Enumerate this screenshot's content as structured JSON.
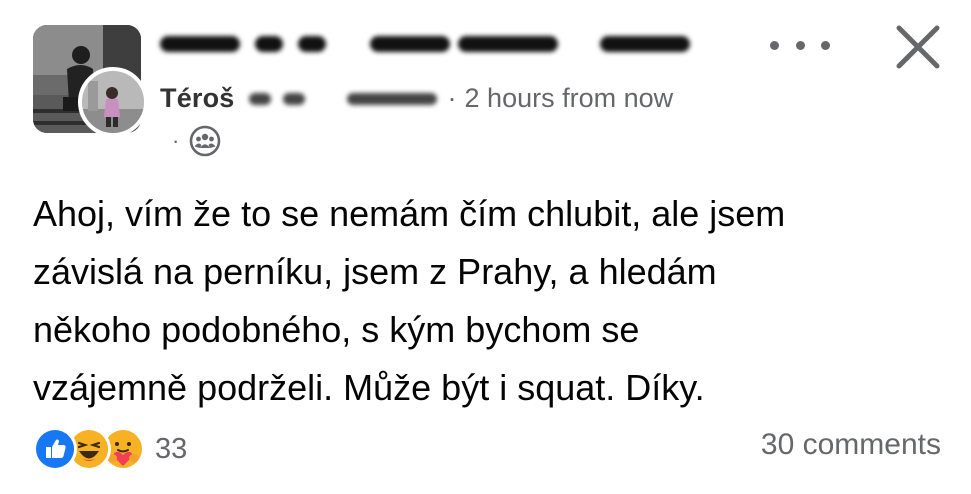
{
  "post": {
    "author": {
      "name": "Téroš"
    },
    "timestamp": "2 hours from now",
    "separator": "·",
    "privacy_separator": "·",
    "privacy_icon": "group-icon",
    "body_lines": [
      "Ahoj, vím že to se nemám čím chlubit, ale jsem",
      "závislá na perníku, jsem z Prahy, a hledám",
      "někoho podobného, s kým bychom se",
      "vzájemně podrželi. Může být i squat. Díky."
    ],
    "reactions": {
      "icons": [
        "like-icon",
        "haha-icon",
        "care-icon"
      ],
      "count": "33"
    },
    "comments_label": "30 comments"
  },
  "colors": {
    "text_primary": "#050505",
    "text_secondary": "#65676b",
    "like_blue": "#1877f2",
    "haha_yellow": "#f7b125"
  }
}
